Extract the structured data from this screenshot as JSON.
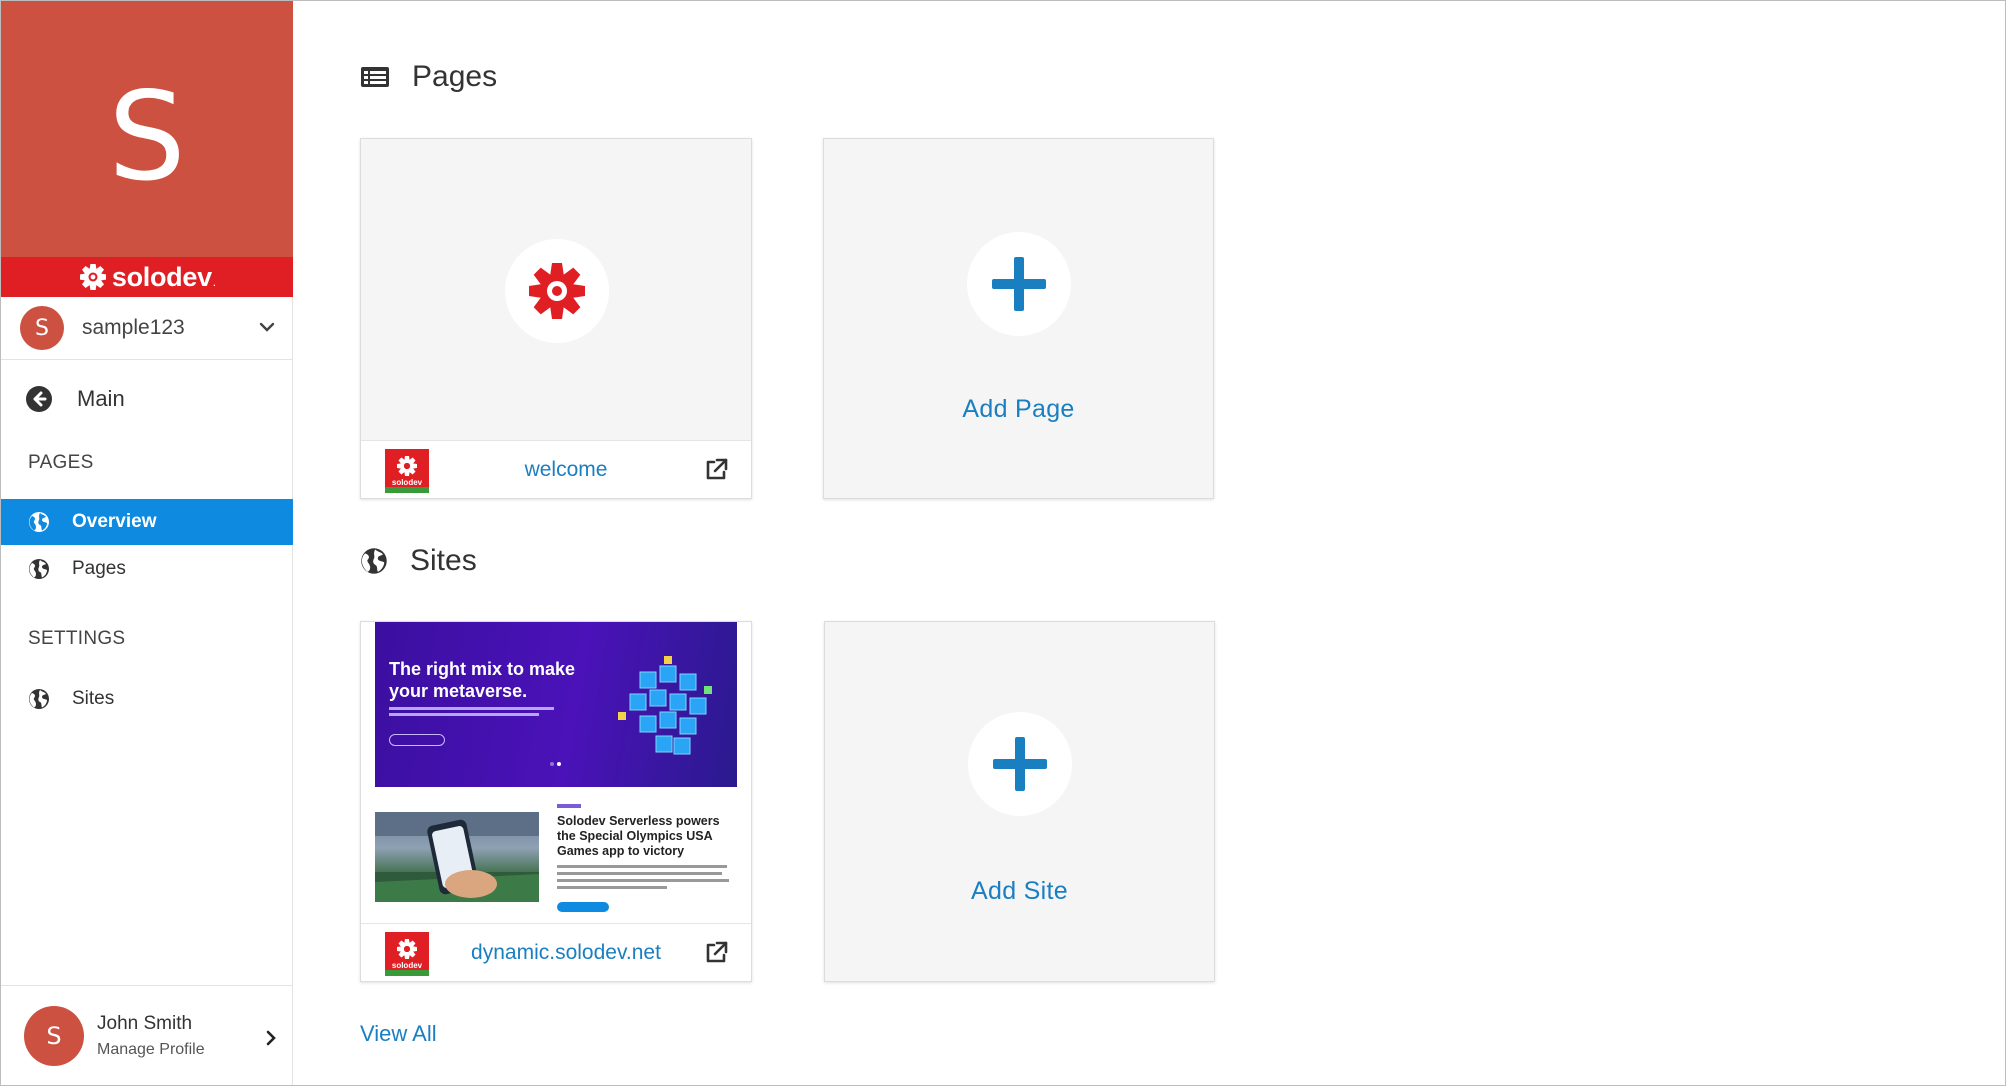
{
  "sidebar": {
    "brand_letter": "S",
    "brand_name": "solodev",
    "brand_mark": ".",
    "site_avatar": "S",
    "site_name": "sample123",
    "main_label": "Main",
    "sections": [
      {
        "label": "PAGES"
      },
      {
        "label": "SETTINGS"
      }
    ],
    "items": [
      {
        "label": "Overview",
        "active": true,
        "icon": "globe-icon"
      },
      {
        "label": "Pages",
        "active": false,
        "icon": "globe-icon"
      },
      {
        "label": "Sites",
        "active": false,
        "icon": "globe-icon"
      }
    ],
    "profile": {
      "avatar": "S",
      "name": "John Smith",
      "subtitle": "Manage Profile"
    }
  },
  "main": {
    "pages_section": {
      "title": "Pages",
      "icon": "list-icon",
      "cards": [
        {
          "link": "welcome"
        }
      ],
      "add_label": "Add Page"
    },
    "sites_section": {
      "title": "Sites",
      "icon": "globe-icon",
      "cards": [
        {
          "link": "dynamic.solodev.net",
          "thumb": {
            "hero_title": "The right mix to make your metaverse.",
            "article_title": "Solodev Serverless powers the Special Olympics USA Games app to victory"
          }
        }
      ],
      "add_label": "Add Site"
    },
    "view_all": "View All"
  },
  "colors": {
    "brand_block": "#cc5140",
    "brand_bar": "#e01f24",
    "active_nav": "#0e8ae0",
    "link": "#1a7fc1",
    "plus_icon": "#1a7fc1"
  }
}
